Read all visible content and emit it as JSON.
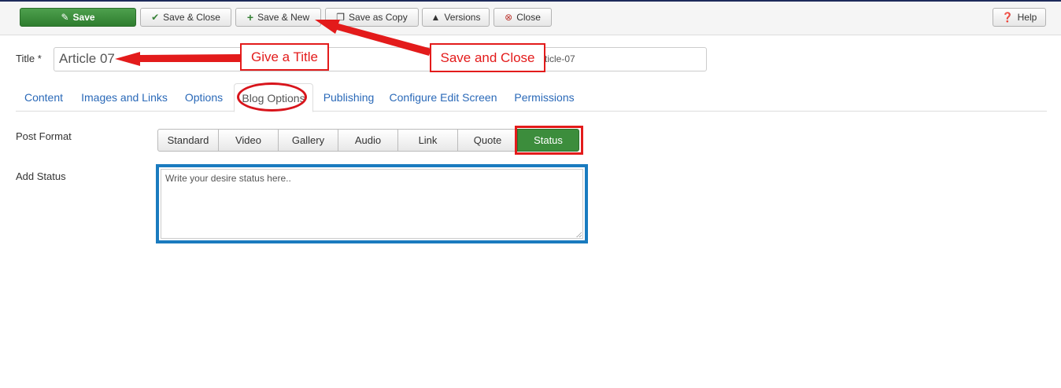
{
  "toolbar": {
    "save_label": "Save",
    "save_close_label": "Save & Close",
    "save_new_label": "Save & New",
    "save_copy_label": "Save as Copy",
    "versions_label": "Versions",
    "close_label": "Close",
    "help_label": "Help"
  },
  "title_field": {
    "label": "Title *",
    "value": "Article 07",
    "alias_partial": "rticle-07"
  },
  "tabs": [
    {
      "label": "Content"
    },
    {
      "label": "Images and Links"
    },
    {
      "label": "Options"
    },
    {
      "label": "Blog Options",
      "active": true
    },
    {
      "label": "Publishing"
    },
    {
      "label": "Configure Edit Screen"
    },
    {
      "label": "Permissions"
    }
  ],
  "post_format": {
    "label": "Post Format",
    "options": [
      "Standard",
      "Video",
      "Gallery",
      "Audio",
      "Link",
      "Quote",
      "Status"
    ],
    "selected": "Status"
  },
  "add_status": {
    "label": "Add Status",
    "value": "Write your desire status here.."
  },
  "annotations": {
    "give_title": "Give a Title",
    "save_and_close": "Save and Close"
  },
  "colors": {
    "accent_green": "#3c8d3c",
    "link_blue": "#2a69b8",
    "annotation_red": "#e31b1b",
    "focus_blue": "#1a7bbf"
  }
}
